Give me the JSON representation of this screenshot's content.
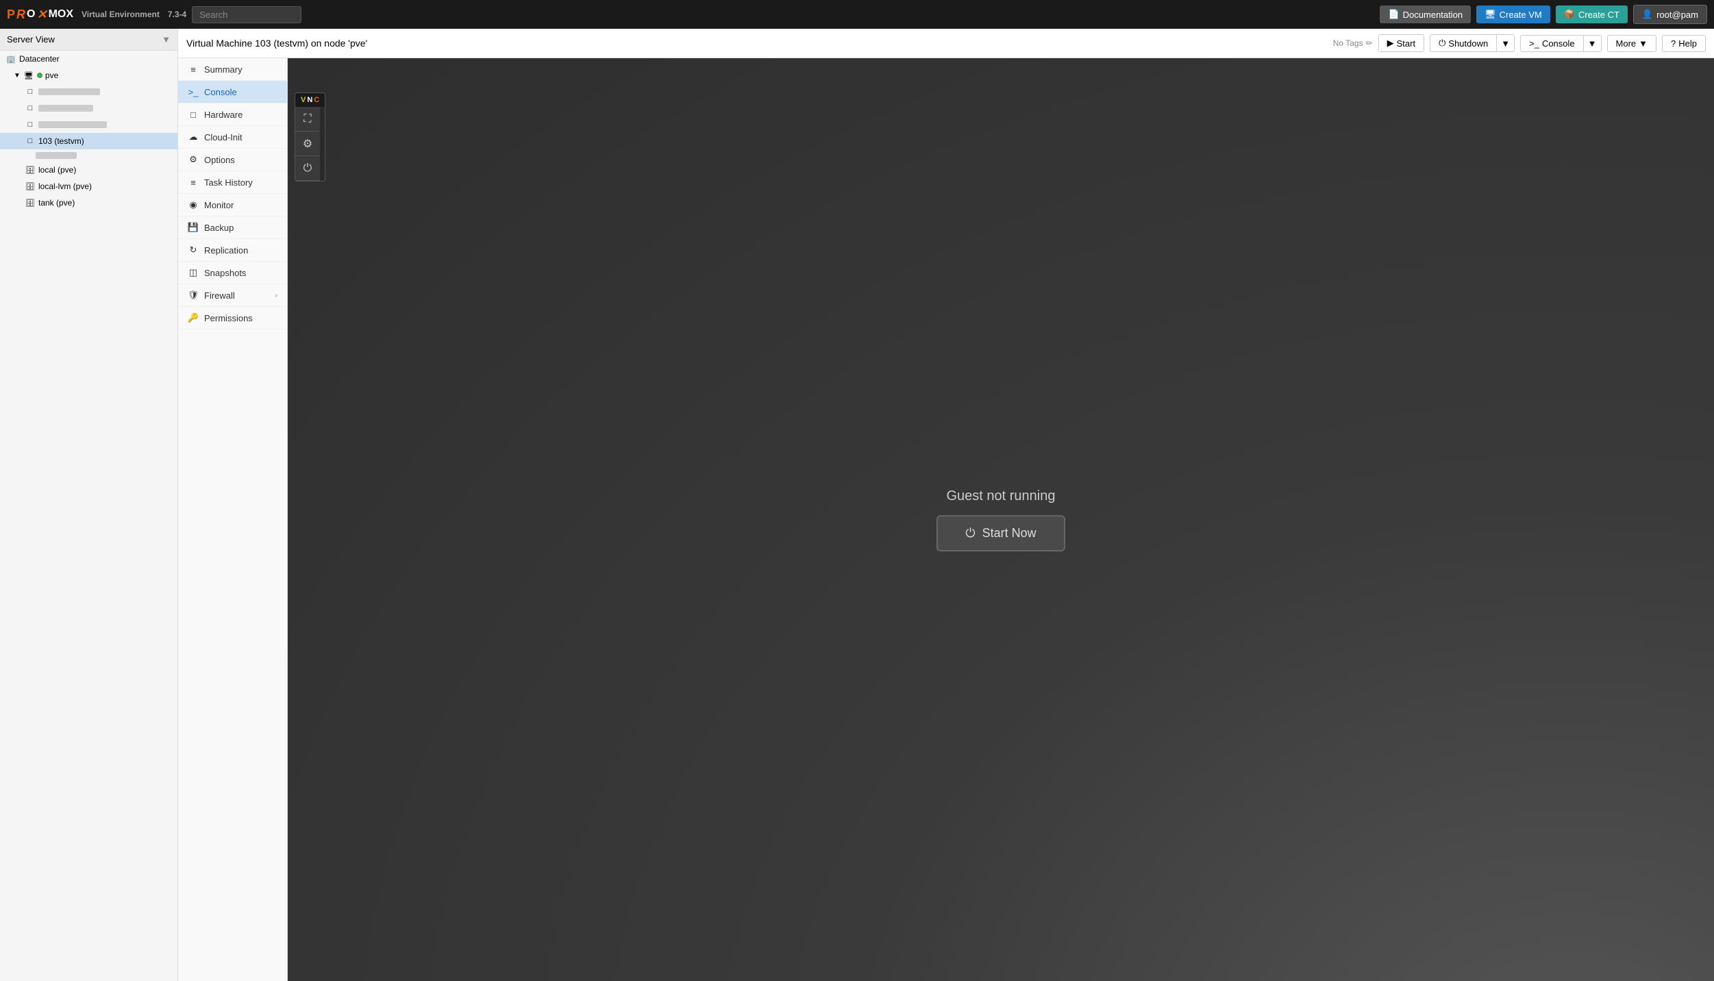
{
  "app": {
    "name": "PROXMOX",
    "product": "Virtual Environment",
    "version": "7.3-4"
  },
  "navbar": {
    "search_placeholder": "Search",
    "doc_label": "Documentation",
    "create_vm_label": "Create VM",
    "create_ct_label": "Create CT",
    "user_label": "root@pam"
  },
  "sidebar": {
    "view_label": "Server View",
    "tree": {
      "datacenter_label": "Datacenter",
      "pve_label": "pve",
      "vm_selected_label": "103 (testvm)",
      "storage": [
        {
          "label": "local (pve)"
        },
        {
          "label": "local-lvm (pve)"
        },
        {
          "label": "tank (pve)"
        }
      ]
    }
  },
  "content": {
    "vm_title": "Virtual Machine 103 (testvm) on node 'pve'",
    "no_tags_label": "No Tags",
    "toolbar": {
      "start_label": "Start",
      "shutdown_label": "Shutdown",
      "console_label": "Console",
      "more_label": "More",
      "help_label": "Help"
    }
  },
  "nav_menu": {
    "items": [
      {
        "id": "summary",
        "label": "Summary",
        "icon": "≡"
      },
      {
        "id": "console",
        "label": "Console",
        "icon": "›_",
        "active": true
      },
      {
        "id": "hardware",
        "label": "Hardware",
        "icon": "□"
      },
      {
        "id": "cloud-init",
        "label": "Cloud-Init",
        "icon": "☁"
      },
      {
        "id": "options",
        "label": "Options",
        "icon": "⚙"
      },
      {
        "id": "task-history",
        "label": "Task History",
        "icon": "≡"
      },
      {
        "id": "monitor",
        "label": "Monitor",
        "icon": "◉"
      },
      {
        "id": "backup",
        "label": "Backup",
        "icon": "□"
      },
      {
        "id": "replication",
        "label": "Replication",
        "icon": "↻"
      },
      {
        "id": "snapshots",
        "label": "Snapshots",
        "icon": "◫"
      },
      {
        "id": "firewall",
        "label": "Firewall",
        "icon": "🛡",
        "has_arrow": true
      },
      {
        "id": "permissions",
        "label": "Permissions",
        "icon": "🔑"
      }
    ]
  },
  "console": {
    "guest_status_text": "Guest not running",
    "start_now_label": "Start Now",
    "vnc_label": "VNC"
  }
}
